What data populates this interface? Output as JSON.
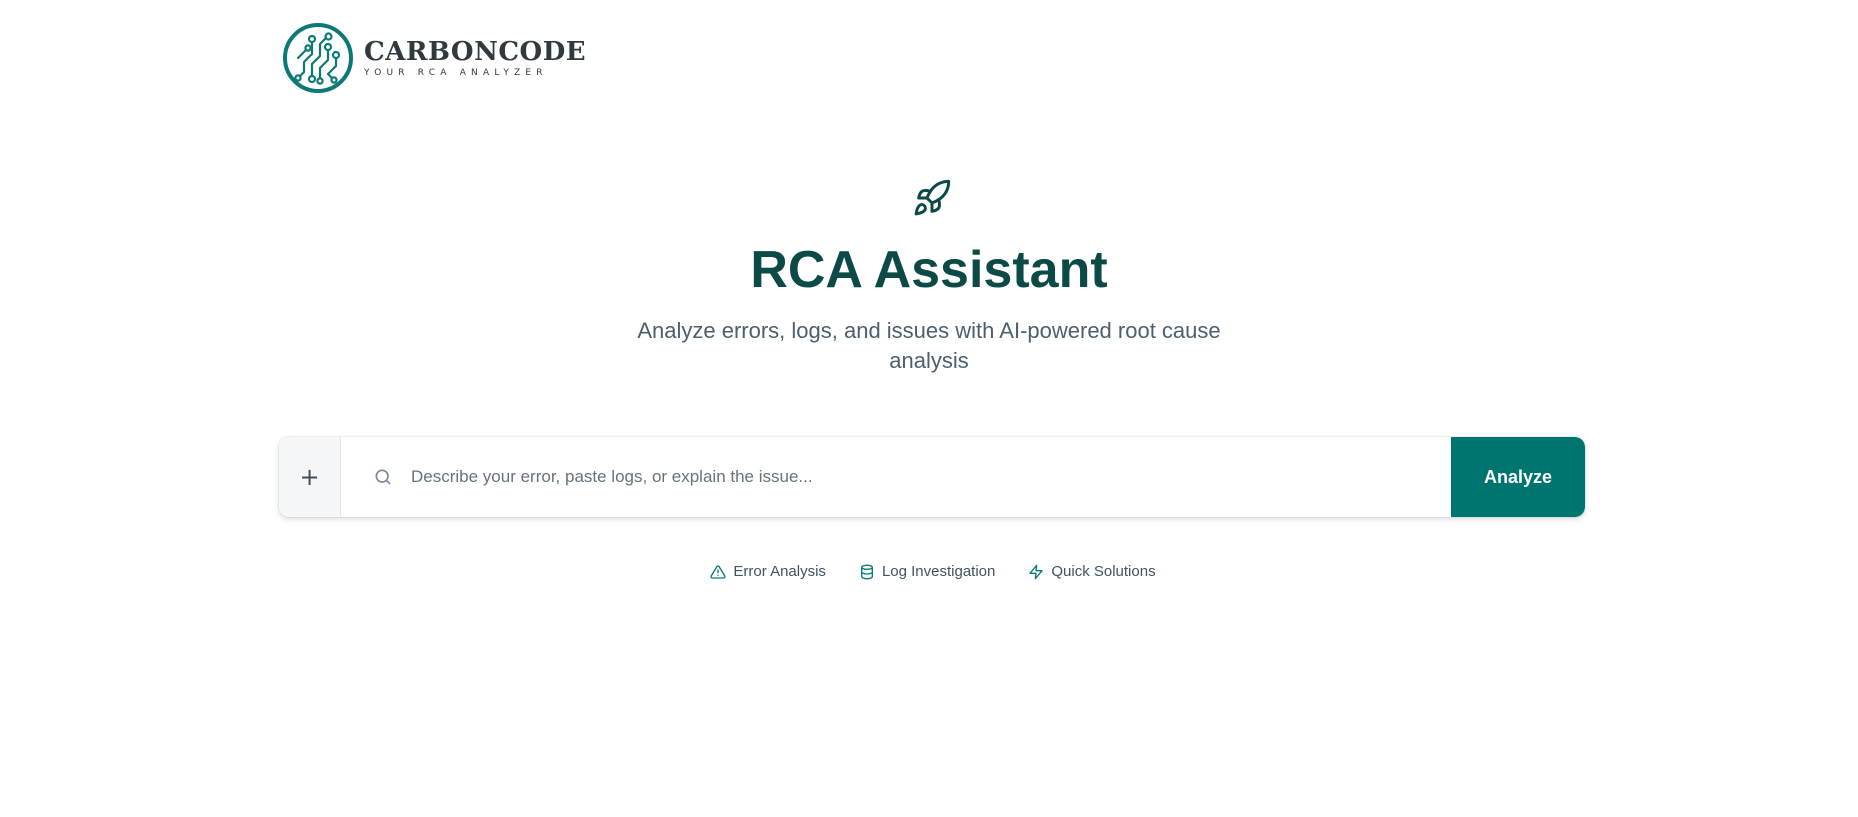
{
  "brand": {
    "name": "CARBONCODE",
    "tagline": "YOUR RCA ANALYZER",
    "color": "#0b7a76"
  },
  "hero": {
    "icon": "rocket-icon",
    "title": "RCA Assistant",
    "subtitle": "Analyze errors, logs, and issues with AI-powered root cause analysis"
  },
  "search": {
    "attach_label": "+",
    "placeholder": "Describe your error, paste logs, or explain the issue...",
    "value": "",
    "submit_label": "Analyze"
  },
  "features": [
    {
      "label": "Error Analysis",
      "icon": "alert-triangle-icon"
    },
    {
      "label": "Log Investigation",
      "icon": "database-icon"
    },
    {
      "label": "Quick Solutions",
      "icon": "lightning-icon"
    }
  ],
  "colors": {
    "accent": "#007570",
    "heading": "#0b4a46",
    "muted": "#4d5f6e"
  }
}
